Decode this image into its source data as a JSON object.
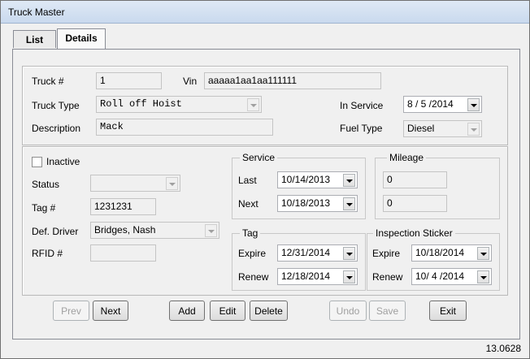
{
  "window": {
    "title": "Truck Master"
  },
  "tabs": [
    {
      "label": "List"
    },
    {
      "label": "Details"
    }
  ],
  "top": {
    "truck_no_label": "Truck #",
    "truck_no_value": "1",
    "vin_label": "Vin",
    "vin_value": "aaaaa1aa1aa111111",
    "truck_type_label": "Truck Type",
    "truck_type_value": "Roll off Hoist",
    "in_service_label": "In Service",
    "in_service_value": "8 / 5 /2014",
    "description_label": "Description",
    "description_value": "Mack",
    "fuel_type_label": "Fuel Type",
    "fuel_type_value": "Diesel"
  },
  "left": {
    "inactive_label": "Inactive",
    "inactive_checked": false,
    "status_label": "Status",
    "status_value": "",
    "tag_label": "Tag #",
    "tag_value": "1231231",
    "driver_label": "Def. Driver",
    "driver_value": "Bridges, Nash",
    "rfid_label": "RFID #",
    "rfid_value": ""
  },
  "service": {
    "title": "Service",
    "last_label": "Last",
    "last_value": "10/14/2013",
    "next_label": "Next",
    "next_value": "10/18/2013"
  },
  "mileage": {
    "title": "Mileage",
    "value1": "0",
    "value2": "0"
  },
  "tag": {
    "title": "Tag",
    "expire_label": "Expire",
    "expire_value": "12/31/2014",
    "renew_label": "Renew",
    "renew_value": "12/18/2014"
  },
  "inspection": {
    "title": "Inspection Sticker",
    "expire_label": "Expire",
    "expire_value": "10/18/2014",
    "renew_label": "Renew",
    "renew_value": "10/ 4 /2014"
  },
  "buttons": {
    "prev": "Prev",
    "next": "Next",
    "add": "Add",
    "edit": "Edit",
    "delete": "Delete",
    "undo": "Undo",
    "save": "Save",
    "exit": "Exit"
  },
  "statusbar": {
    "version": "13.0628"
  }
}
